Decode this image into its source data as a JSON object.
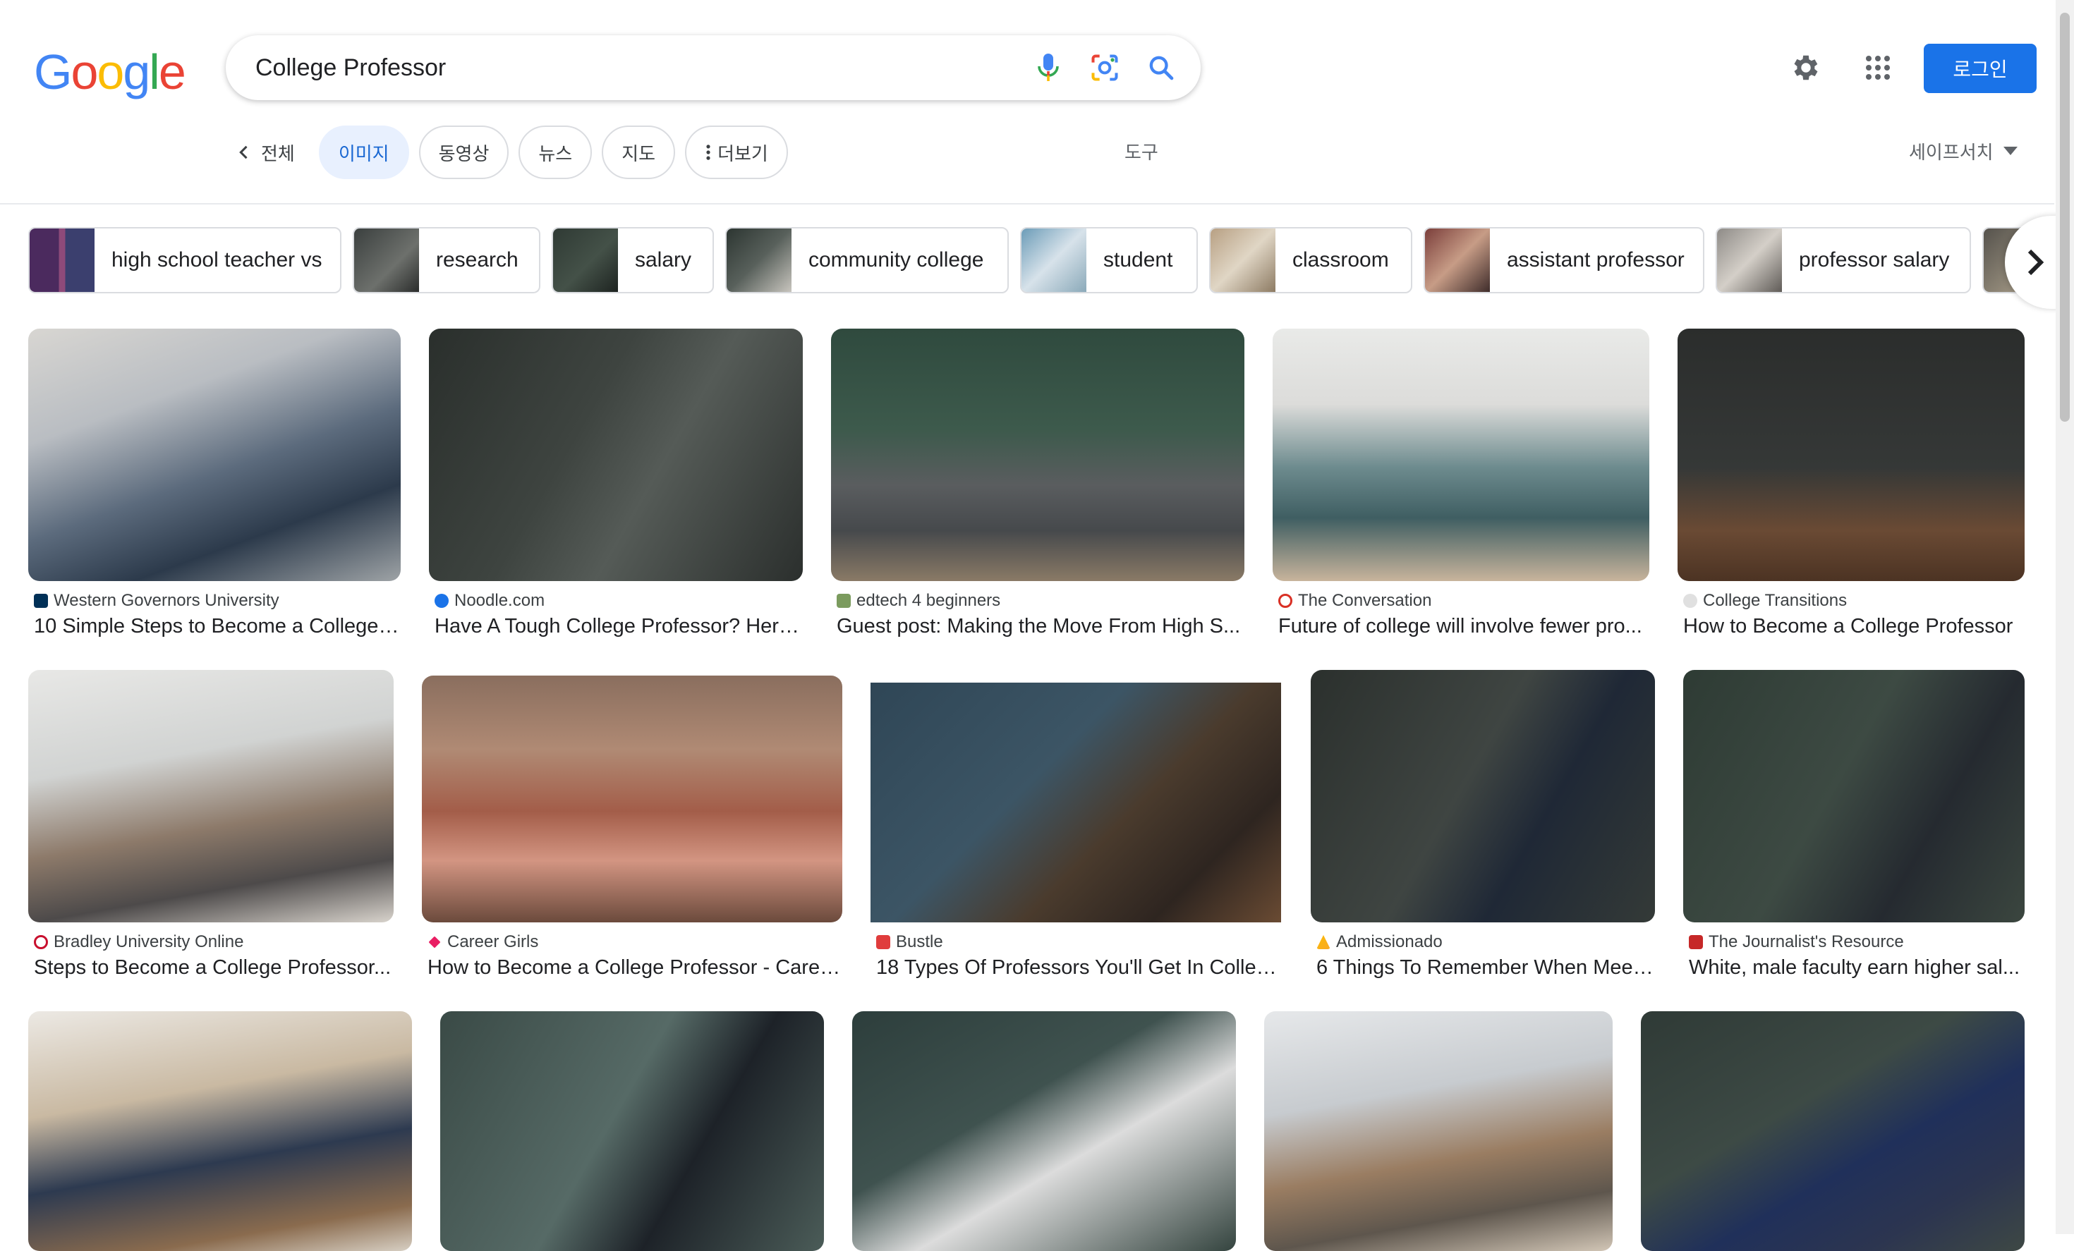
{
  "logo": {
    "letters": [
      "G",
      "o",
      "o",
      "g",
      "l",
      "e"
    ],
    "colors": [
      "#4285F4",
      "#EA4335",
      "#FBBC05",
      "#4285F4",
      "#34A853",
      "#EA4335"
    ]
  },
  "search": {
    "query": "College Professor",
    "icons": [
      "mic-icon",
      "lens-icon",
      "search-icon"
    ]
  },
  "header": {
    "login_label": "로그인"
  },
  "tabs": [
    {
      "label": "전체",
      "type": "back"
    },
    {
      "label": "이미지",
      "active": true
    },
    {
      "label": "동영상"
    },
    {
      "label": "뉴스"
    },
    {
      "label": "지도"
    },
    {
      "label": "더보기"
    }
  ],
  "tools_label": "도구",
  "safesearch_label": "세이프서치",
  "chips": [
    {
      "label": "high school teacher vs"
    },
    {
      "label": "research"
    },
    {
      "label": "salary"
    },
    {
      "label": "community college"
    },
    {
      "label": "student"
    },
    {
      "label": "classroom"
    },
    {
      "label": "assistant professor"
    },
    {
      "label": "professor salary"
    }
  ],
  "results": [
    {
      "source": "Western Governors University",
      "title": "10 Simple Steps to Become a College ..."
    },
    {
      "source": "Noodle.com",
      "title": "Have A Tough College Professor? Here..."
    },
    {
      "source": "edtech 4 beginners",
      "title": "Guest post: Making the Move From High S..."
    },
    {
      "source": "The Conversation",
      "title": "Future of college will involve fewer pro..."
    },
    {
      "source": "College Transitions",
      "title": "How to Become a College Professor"
    },
    {
      "source": "Bradley University Online",
      "title": "Steps to Become a College Professor..."
    },
    {
      "source": "Career Girls",
      "title": "How to Become a College Professor - Caree..."
    },
    {
      "source": "Bustle",
      "title": "18 Types Of Professors You'll Get In Colleg..."
    },
    {
      "source": "Admissionado",
      "title": "6 Things To Remember When Meet..."
    },
    {
      "source": "The Journalist's Resource",
      "title": "White, male faculty earn higher sal..."
    },
    {
      "source": "",
      "title": ""
    },
    {
      "source": "",
      "title": ""
    },
    {
      "source": "",
      "title": ""
    },
    {
      "source": "",
      "title": ""
    },
    {
      "source": "",
      "title": ""
    }
  ]
}
